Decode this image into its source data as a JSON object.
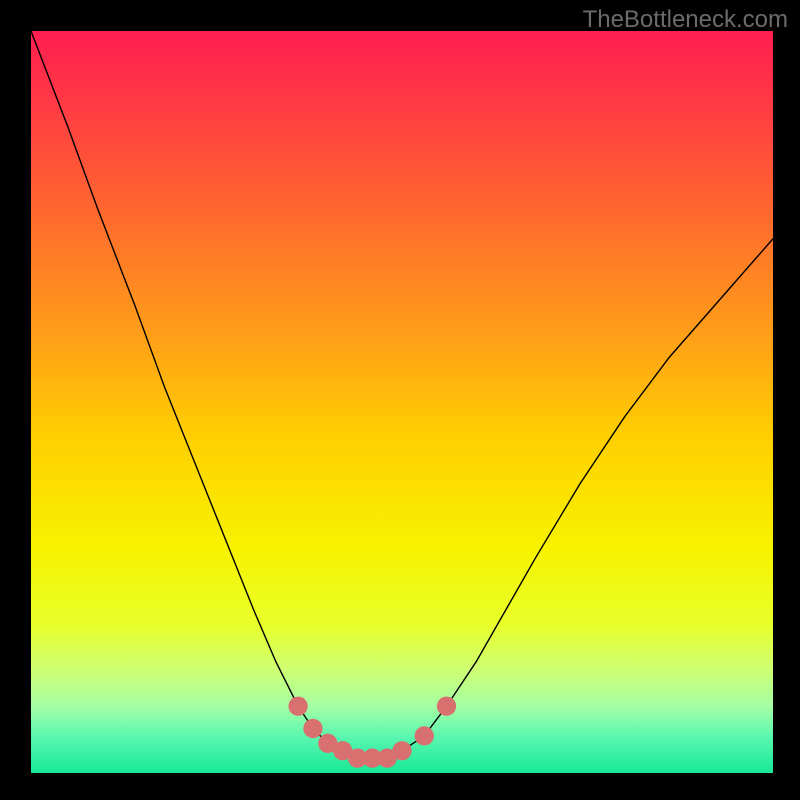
{
  "watermark": "TheBottleneck.com",
  "chart_data": {
    "type": "line",
    "title": "",
    "xlabel": "",
    "ylabel": "",
    "xlim": [
      0,
      100
    ],
    "ylim": [
      0,
      100
    ],
    "series": [
      {
        "name": "curve",
        "x": [
          0,
          5,
          9,
          14,
          18,
          22,
          26,
          30,
          33,
          36,
          38,
          40,
          42,
          44,
          46,
          48,
          50,
          53,
          56,
          60,
          64,
          68,
          74,
          80,
          86,
          93,
          100
        ],
        "y": [
          100,
          87,
          76,
          63,
          52,
          42,
          32,
          22,
          15,
          9,
          6,
          4,
          3,
          2,
          2,
          2,
          3,
          5,
          9,
          15,
          22,
          29,
          39,
          48,
          56,
          64,
          72
        ]
      }
    ],
    "markers": [
      {
        "x": 36,
        "y": 9
      },
      {
        "x": 38,
        "y": 6
      },
      {
        "x": 40,
        "y": 4
      },
      {
        "x": 42,
        "y": 3
      },
      {
        "x": 44,
        "y": 2
      },
      {
        "x": 46,
        "y": 2
      },
      {
        "x": 48,
        "y": 2
      },
      {
        "x": 50,
        "y": 3
      },
      {
        "x": 53,
        "y": 5
      },
      {
        "x": 56,
        "y": 9
      }
    ],
    "gradient_stops": [
      {
        "offset": 0,
        "color": "#ff1e50"
      },
      {
        "offset": 0.1,
        "color": "#ff3a44"
      },
      {
        "offset": 0.25,
        "color": "#ff6a2d"
      },
      {
        "offset": 0.4,
        "color": "#ff9b1a"
      },
      {
        "offset": 0.55,
        "color": "#ffd000"
      },
      {
        "offset": 0.7,
        "color": "#f7f300"
      },
      {
        "offset": 0.8,
        "color": "#e8ff2a"
      },
      {
        "offset": 0.86,
        "color": "#ceff72"
      },
      {
        "offset": 0.91,
        "color": "#a4ffa4"
      },
      {
        "offset": 0.95,
        "color": "#5cf7b0"
      },
      {
        "offset": 1.0,
        "color": "#17e896"
      }
    ],
    "marker_color": "#d97070"
  }
}
